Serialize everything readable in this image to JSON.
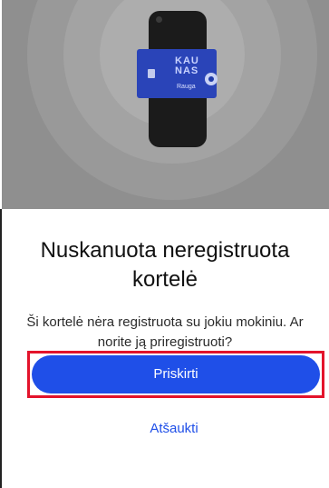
{
  "illustration": {
    "card_logo_text": "KAU\nNAS",
    "card_logo_subtext": "Rauga",
    "icons": [
      "phone-icon",
      "card-icon"
    ]
  },
  "dialog": {
    "title": "Nuskanuota neregistruota kortelė",
    "message": "Ši kortelė nėra registruota su jokiu mokiniu. Ar norite ją priregistruoti?",
    "primary_button": "Priskirti",
    "secondary_button": "Atšaukti"
  },
  "colors": {
    "accent": "#1f4fe8",
    "highlight": "#e3132b",
    "card": "#2a44b8"
  }
}
